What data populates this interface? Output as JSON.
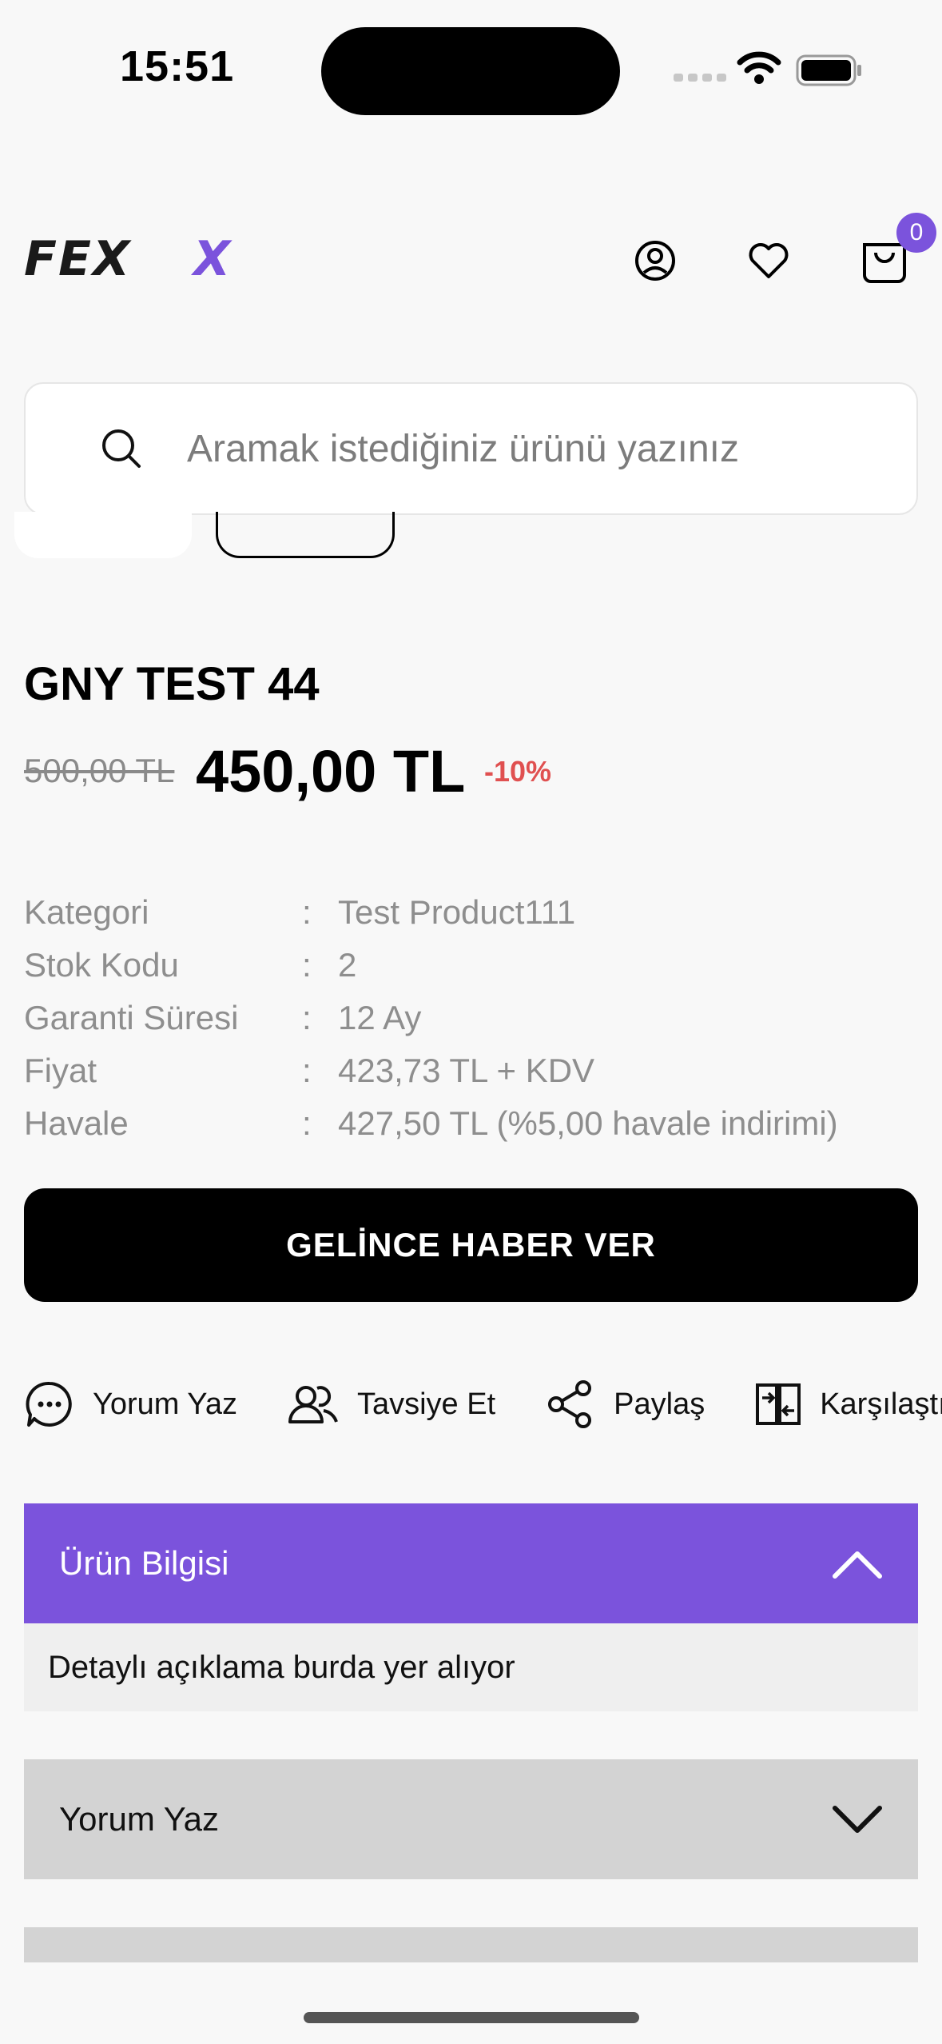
{
  "status_bar": {
    "time": "15:51"
  },
  "header": {
    "logo_text": "FEXX",
    "cart_count": "0"
  },
  "search": {
    "placeholder": "Aramak istediğiniz ürünü yazınız"
  },
  "product": {
    "title": "GNY TEST 44",
    "old_price": "500,00 TL",
    "price": "450,00 TL",
    "discount": "-10%"
  },
  "specs": [
    {
      "label": "Kategori",
      "sep": ":",
      "value": "Test Product111"
    },
    {
      "label": "Stok Kodu",
      "sep": ":",
      "value": "2"
    },
    {
      "label": "Garanti Süresi",
      "sep": ":",
      "value": "12 Ay"
    },
    {
      "label": "Fiyat",
      "sep": ":",
      "value": "423,73 TL + KDV"
    },
    {
      "label": "Havale",
      "sep": ":",
      "value": "427,50 TL (%5,00 havale indirimi)"
    }
  ],
  "notify_button": "GELİNCE HABER VER",
  "actions": [
    {
      "label": "Yorum Yaz",
      "icon": "comment-icon"
    },
    {
      "label": "Tavsiye Et",
      "icon": "users-icon"
    },
    {
      "label": "Paylaş",
      "icon": "share-icon"
    },
    {
      "label": "Karşılaştır",
      "icon": "compare-icon"
    }
  ],
  "accordion": {
    "info_title": "Ürün Bilgisi",
    "info_body": "Detaylı açıklama burda yer alıyor",
    "review_title": "Yorum Yaz"
  },
  "colors": {
    "accent": "#7b53dc",
    "discount": "#e05050",
    "muted": "#8e8e8e"
  }
}
